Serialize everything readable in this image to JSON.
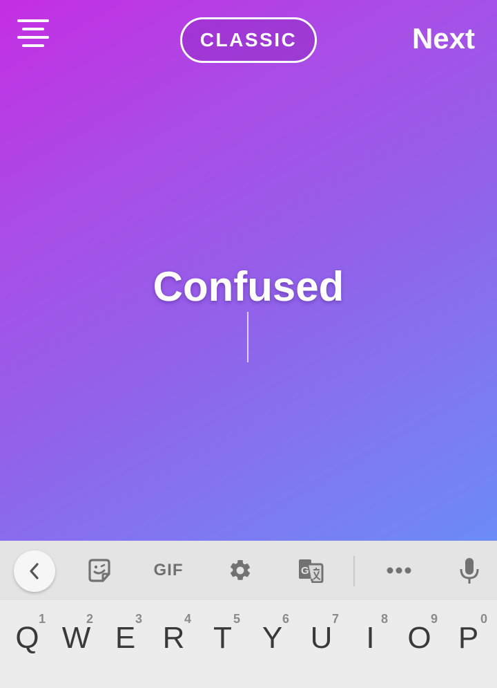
{
  "editor": {
    "mode_label": "CLASSIC",
    "next_label": "Next",
    "story_text": "Confused",
    "gradient": {
      "start": "#c42ee2",
      "end": "#6c8cf4"
    }
  },
  "keyboard_toolbar": {
    "items": [
      {
        "name": "back",
        "icon": "chevron-left-icon"
      },
      {
        "name": "sticker",
        "icon": "sticker-icon"
      },
      {
        "name": "gif",
        "label": "GIF"
      },
      {
        "name": "settings",
        "icon": "gear-icon"
      },
      {
        "name": "translate",
        "icon": "translate-icon"
      },
      {
        "name": "more",
        "icon": "more-horizontal-icon"
      },
      {
        "name": "voice",
        "icon": "microphone-icon"
      }
    ]
  },
  "keyboard": {
    "row1": [
      {
        "letter": "Q",
        "hint": "1"
      },
      {
        "letter": "W",
        "hint": "2"
      },
      {
        "letter": "E",
        "hint": "3"
      },
      {
        "letter": "R",
        "hint": "4"
      },
      {
        "letter": "T",
        "hint": "5"
      },
      {
        "letter": "Y",
        "hint": "6"
      },
      {
        "letter": "U",
        "hint": "7"
      },
      {
        "letter": "I",
        "hint": "8"
      },
      {
        "letter": "O",
        "hint": "9"
      },
      {
        "letter": "P",
        "hint": "0"
      }
    ]
  }
}
